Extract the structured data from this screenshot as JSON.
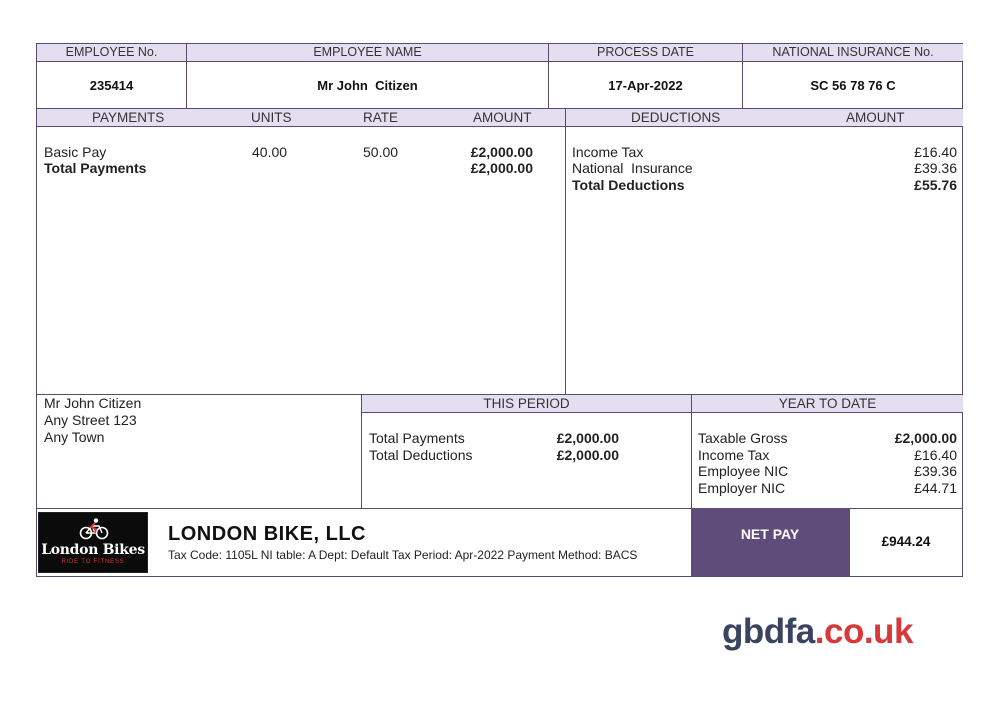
{
  "header": {
    "employee_no_label": "EMPLOYEE No.",
    "employee_name_label": "EMPLOYEE NAME",
    "process_date_label": "PROCESS DATE",
    "ni_label": "NATIONAL INSURANCE No.",
    "employee_no": "235414",
    "employee_name": "Mr John  Citizen",
    "process_date": "17-Apr-2022",
    "ni_number": "SC 56 78 76 C"
  },
  "payments": {
    "headers": {
      "payments": "PAYMENTS",
      "units": "UNITS",
      "rate": "RATE",
      "amount": "AMOUNT"
    },
    "rows": [
      {
        "label": "Basic Pay",
        "units": "40.00",
        "rate": "50.00",
        "amount": "£2,000.00"
      },
      {
        "label": "Total Payments",
        "units": "",
        "rate": "",
        "amount": "£2,000.00"
      }
    ]
  },
  "deductions": {
    "headers": {
      "deductions": "DEDUCTIONS",
      "amount": "AMOUNT"
    },
    "rows": [
      {
        "label": "Income Tax",
        "amount": "£16.40"
      },
      {
        "label": "National  Insurance",
        "amount": "£39.36"
      },
      {
        "label": "Total Deductions",
        "amount": "£55.76"
      }
    ]
  },
  "address": [
    "Mr John Citizen",
    "Any Street 123",
    "Any Town"
  ],
  "this_period": {
    "label": "THIS PERIOD",
    "rows": [
      {
        "label": "Total Payments",
        "amount": "£2,000.00"
      },
      {
        "label": "Total Deductions",
        "amount": "£2,000.00"
      }
    ]
  },
  "year_to_date": {
    "label": "YEAR TO DATE",
    "rows": [
      {
        "label": "Taxable Gross",
        "amount": "£2,000.00"
      },
      {
        "label": "Income Tax",
        "amount": "£16.40"
      },
      {
        "label": "Employee NIC",
        "amount": "£39.36"
      },
      {
        "label": "Employer NIC",
        "amount": "£44.71"
      }
    ]
  },
  "company": {
    "logo_name": "London Bikes",
    "logo_tagline": "RIDE TO FITNESS",
    "name": "LONDON BIKE, LLC",
    "details": "Tax Code: 1105L NI table: A  Dept: Default  Tax Period: Apr-2022   Payment Method: BACS"
  },
  "net_pay": {
    "label": "NET PAY",
    "value": "£944.24"
  },
  "watermark": {
    "part1": "gbdfa",
    "part2": ".co.uk"
  },
  "colors": {
    "header_bg": "#e4dff0",
    "border": "#5a4a6e",
    "net_pay_bg": "#5f4c7b",
    "watermark_dark": "#3a4460",
    "watermark_red": "#d8383a"
  }
}
